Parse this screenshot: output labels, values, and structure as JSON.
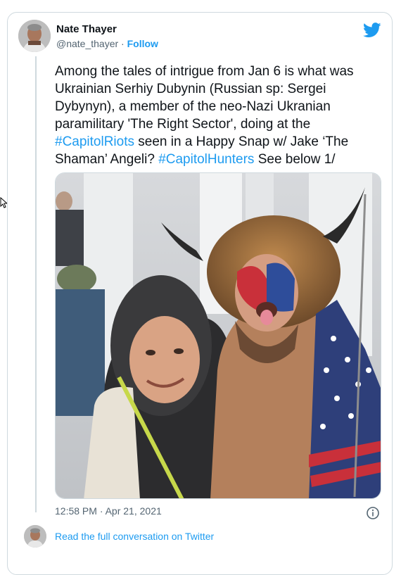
{
  "tweet": {
    "author_name": "Nate Thayer",
    "author_handle": "@nate_thayer",
    "separator": " · ",
    "follow_label": "Follow",
    "text_segments": [
      {
        "text": "Among the tales of intrigue from Jan 6 is what was Ukrainian Serhiy Dubynin (Russian sp: Sergei Dybynyn), a member of the neo-Nazi Ukranian paramilitary 'The Right Sector', doing at the ",
        "type": "plain"
      },
      {
        "text": "#CapitolRiots",
        "type": "hashtag"
      },
      {
        "text": " seen in a Happy Snap w/ Jake ‘The Shaman’ Angeli? ",
        "type": "plain"
      },
      {
        "text": "#CapitolHunters",
        "type": "hashtag"
      },
      {
        "text": " See below 1/",
        "type": "plain"
      }
    ],
    "timestamp": "12:58 PM · Apr 21, 2021",
    "read_more_label": "Read the full conversation on Twitter"
  },
  "icons": {
    "brand": "twitter-bird-icon",
    "info": "info-icon",
    "cursor": "mouse-cursor-icon"
  },
  "colors": {
    "link": "#1d9bf0",
    "text": "#0f1419",
    "secondary": "#536471",
    "border": "#cfd9de"
  }
}
